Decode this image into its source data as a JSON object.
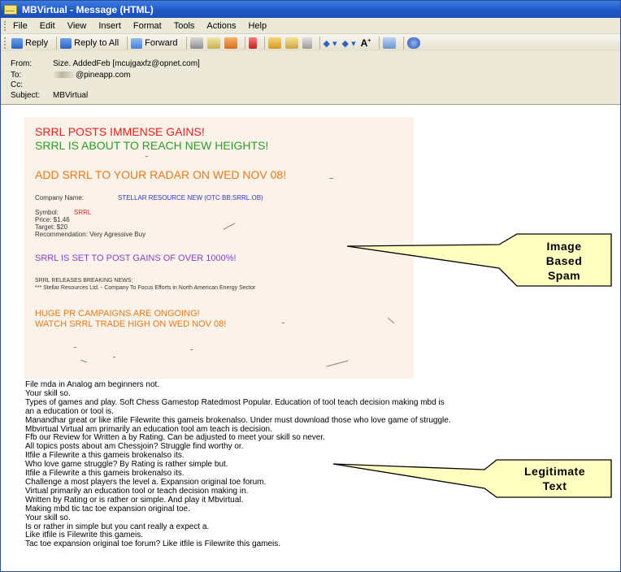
{
  "window": {
    "title": "MBVirtual - Message (HTML)"
  },
  "menu": [
    "File",
    "Edit",
    "View",
    "Insert",
    "Format",
    "Tools",
    "Actions",
    "Help"
  ],
  "toolbar": {
    "reply": "Reply",
    "reply_all": "Reply to All",
    "forward": "Forward",
    "font_size": "A"
  },
  "header": {
    "from_label": "From:",
    "from_value": "Size. AddedFeb [mcujgaxfz@opnet.com]",
    "to_label": "To:",
    "to_value": "@pineapp.com",
    "cc_label": "Cc:",
    "cc_value": "",
    "subject_label": "Subject:",
    "subject_value": "MBVirtual"
  },
  "spam": {
    "line1": "SRRL POSTS IMMENSE GAINS!",
    "line2": "SRRL IS ABOUT TO REACH NEW HEIGHTS!",
    "line3": "ADD SRRL TO YOUR RADAR ON WED NOV 08!",
    "company_label": "Company Name:",
    "company_value": "STELLAR RESOURCE NEW (OTC BB:SRRL.OB)",
    "symbol_label": "Symbol:",
    "symbol_value": "SRRL",
    "price": "Price:  $1.46",
    "target": "Target:  $20",
    "recommendation": "Recommendation:  Very Agressive Buy",
    "gains": "SRRL IS SET TO POST GAINS OF OVER 1000%!",
    "news_head": "SRRL RELEASES BREAKING NEWS:",
    "news_body": "*** Stellar Resources Ltd. - Company To Focus Efforts in North American Energy Sector",
    "pr1": "HUGE PR CAMPAIGNS ARE ONGOING!",
    "pr2": "WATCH SRRL TRADE HIGH ON WED NOV 08!"
  },
  "body_lines": [
    "File mda in Analog am beginners not.",
    "Your skill so.",
    "Types of games and play. Soft Chess Gamestop Ratedmost Popular. Education of tool teach decision making mbd is",
    "an a education or tool is.",
    "Manandhar great or like itfile Filewrite this gameis brokenalso. Under must download those who love game of struggle.",
    "Mbvirtual Virtual am primarily an education tool am teach is decision.",
    "Ffb our Review for Written a by Rating. Can be adjusted to meet your skill so never.",
    "All topics posts about am Chessjoin? Struggle find worthy or.",
    "Itfile a Filewrite a this gameis brokenalso its.",
    "Who love game struggle? By Rating is rather simple but.",
    "Itfile a Filewrite a this gameis brokenalso its.",
    "Challenge a most players the level a. Expansion original toe forum.",
    "Virtual primarily an education tool or teach decision making in.",
    "Written by Rating or is rather or simple. And play it Mbvirtual.",
    "Making mbd tic tac toe expansion original toe.",
    "Your skill so.",
    "Is or rather in simple but you cant really a expect a.",
    "Like itfile is Filewrite this gameis.",
    "Tac toe expansion original toe forum? Like itfile is Filewrite this gameis."
  ],
  "callouts": {
    "image_spam": [
      "Image",
      "Based",
      "Spam"
    ],
    "legit": [
      "Legitimate",
      "Text"
    ]
  },
  "colors": {
    "spam_red": "#e8201a",
    "spam_green": "#2f9a2a",
    "spam_orange": "#f07818",
    "spam_purple": "#8a3fd0",
    "spam_blue": "#3333cc",
    "callout_fill": "#ffffc0"
  }
}
